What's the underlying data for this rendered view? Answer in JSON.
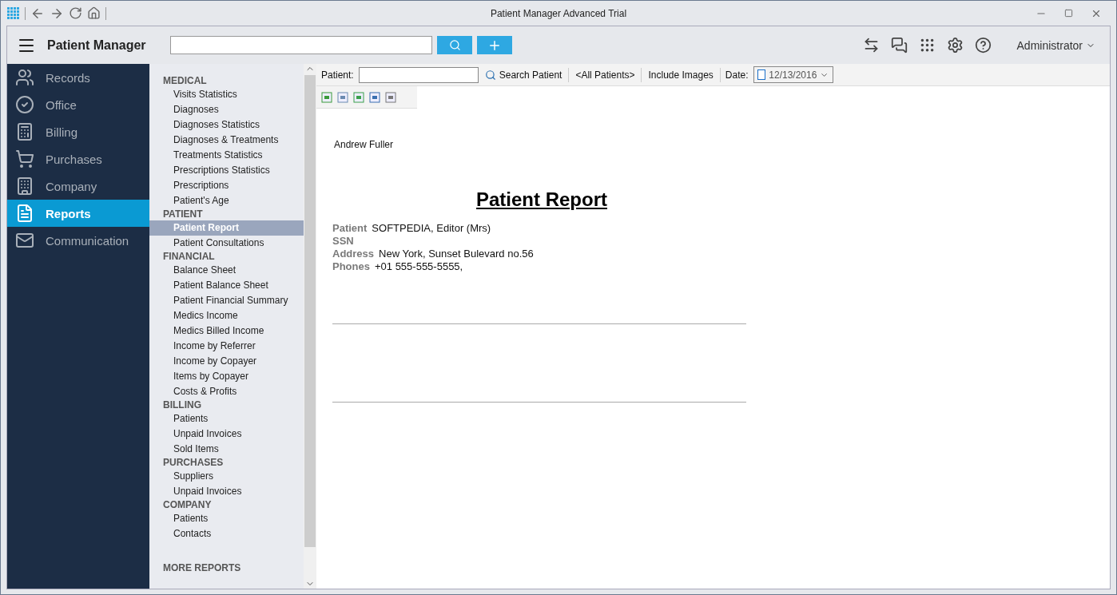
{
  "window": {
    "title": "Patient Manager Advanced Trial"
  },
  "header": {
    "app_name": "Patient Manager",
    "user": "Administrator"
  },
  "nav": [
    {
      "label": "Records",
      "selected": false
    },
    {
      "label": "Office",
      "selected": false
    },
    {
      "label": "Billing",
      "selected": false
    },
    {
      "label": "Purchases",
      "selected": false
    },
    {
      "label": "Company",
      "selected": false
    },
    {
      "label": "Reports",
      "selected": true
    },
    {
      "label": "Communication",
      "selected": false
    }
  ],
  "report_sections": [
    {
      "heading": "MEDICAL",
      "items": [
        {
          "label": "Visits Statistics",
          "selected": false
        },
        {
          "label": "Diagnoses",
          "selected": false
        },
        {
          "label": "Diagnoses Statistics",
          "selected": false
        },
        {
          "label": "Diagnoses & Treatments",
          "selected": false
        },
        {
          "label": "Treatments Statistics",
          "selected": false
        },
        {
          "label": "Prescriptions Statistics",
          "selected": false
        },
        {
          "label": "Prescriptions",
          "selected": false
        },
        {
          "label": "Patient's Age",
          "selected": false
        }
      ]
    },
    {
      "heading": "PATIENT",
      "items": [
        {
          "label": "Patient Report",
          "selected": true
        },
        {
          "label": "Patient Consultations",
          "selected": false
        }
      ]
    },
    {
      "heading": "FINANCIAL",
      "items": [
        {
          "label": "Balance Sheet",
          "selected": false
        },
        {
          "label": "Patient Balance Sheet",
          "selected": false
        },
        {
          "label": "Patient Financial Summary",
          "selected": false
        },
        {
          "label": "Medics Income",
          "selected": false
        },
        {
          "label": "Medics Billed Income",
          "selected": false
        },
        {
          "label": "Income by Referrer",
          "selected": false
        },
        {
          "label": "Income by Copayer",
          "selected": false
        },
        {
          "label": "Items by Copayer",
          "selected": false
        },
        {
          "label": "Costs & Profits",
          "selected": false
        }
      ]
    },
    {
      "heading": "BILLING",
      "items": [
        {
          "label": "Patients",
          "selected": false
        },
        {
          "label": "Unpaid Invoices",
          "selected": false
        },
        {
          "label": "Sold Items",
          "selected": false
        }
      ]
    },
    {
      "heading": "PURCHASES",
      "items": [
        {
          "label": "Suppliers",
          "selected": false
        },
        {
          "label": "Unpaid Invoices",
          "selected": false
        }
      ]
    },
    {
      "heading": "COMPANY",
      "items": [
        {
          "label": "Patients",
          "selected": false
        },
        {
          "label": "Contacts",
          "selected": false
        }
      ]
    },
    {
      "heading": "MORE REPORTS"
    }
  ],
  "filter_bar": {
    "patient_label": "Patient:",
    "search_button": "Search Patient",
    "all_patients": "<All Patients>",
    "include_images": "Include Images",
    "date_label": "Date:",
    "date_checked": false,
    "date_value": "12/13/2016"
  },
  "report": {
    "doctor": "Andrew Fuller",
    "title": "Patient Report",
    "fields": [
      {
        "label": "Patient",
        "value": "SOFTPEDIA, Editor (Mrs)"
      },
      {
        "label": "SSN"
      },
      {
        "label": "Address",
        "value": "New York, Sunset Bulevard no.56"
      },
      {
        "label": "Phones",
        "value": "+01 555-555-5555,"
      }
    ]
  }
}
